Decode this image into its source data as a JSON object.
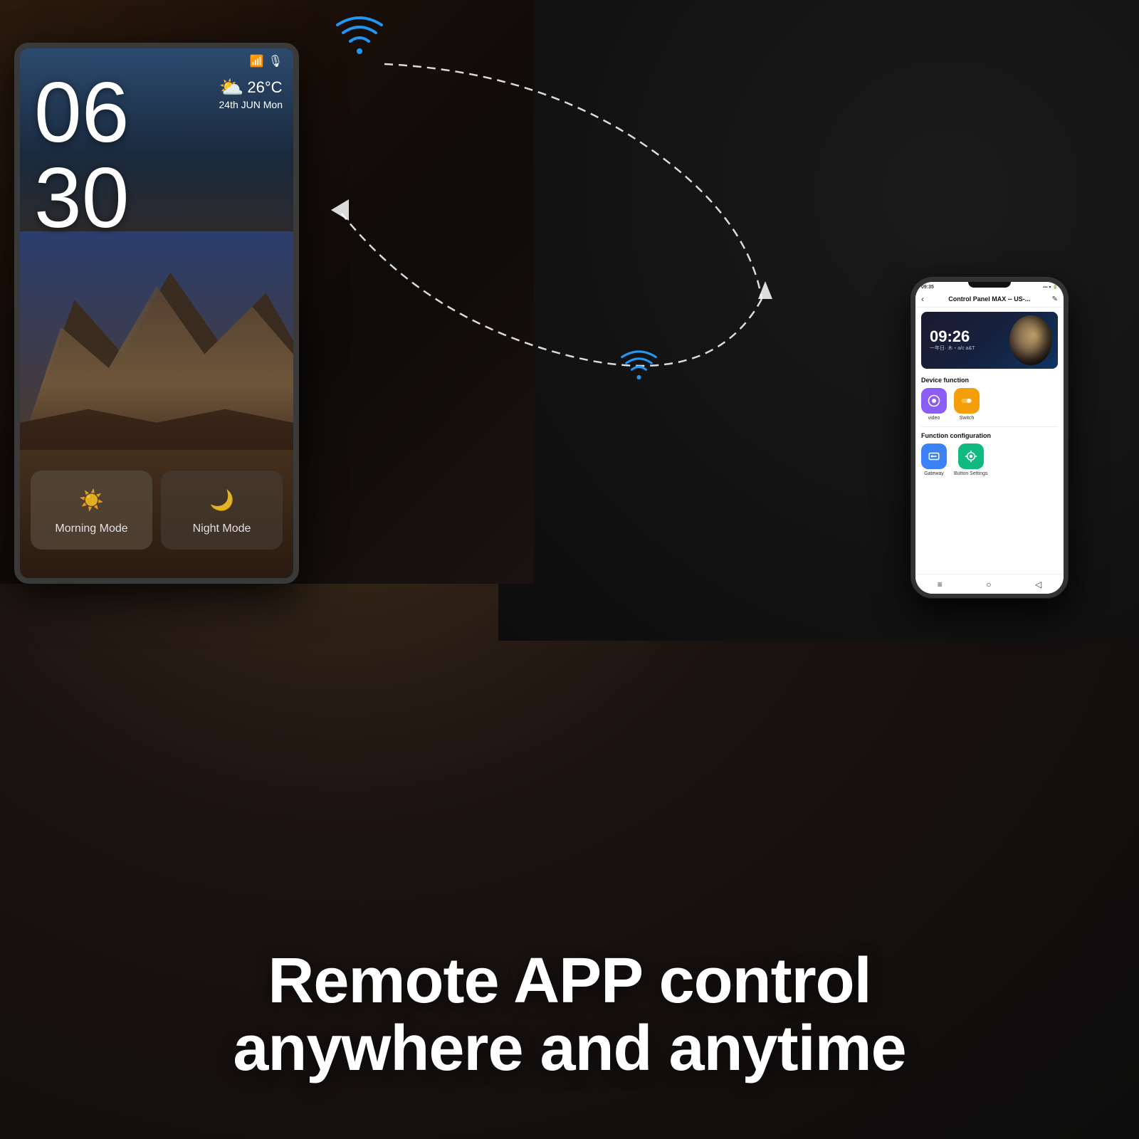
{
  "background": {
    "color_left": "#2a1a0e",
    "color_right": "#0d0d0d"
  },
  "tablet": {
    "time_hour": "06",
    "time_minute": "30",
    "weather_icon": "⛅",
    "weather_temp": "26°C",
    "weather_date": "24th JUN  Mon",
    "mode_morning_icon": "☀",
    "mode_morning_label": "Morning Mode",
    "mode_night_icon": "🌙",
    "mode_night_label": "Night Mode"
  },
  "phone": {
    "status_time": "09:35",
    "title": "Control Panel MAX -- US-...",
    "banner_clock": "09:26",
    "banner_date_line1": "一年日· 木・a/c a&T",
    "device_function_title": "Device function",
    "func_video_label": "video",
    "func_switch_label": "Switch",
    "function_config_title": "Function configuration",
    "func_gateway_label": "Gateway",
    "func_button_settings_label": "Button Settings",
    "nav_menu": "≡",
    "nav_home": "○",
    "nav_back": "◁"
  },
  "headline": {
    "line1": "Remote APP control",
    "line2": "anywhere and anytime"
  },
  "wifi_icon": "📶"
}
